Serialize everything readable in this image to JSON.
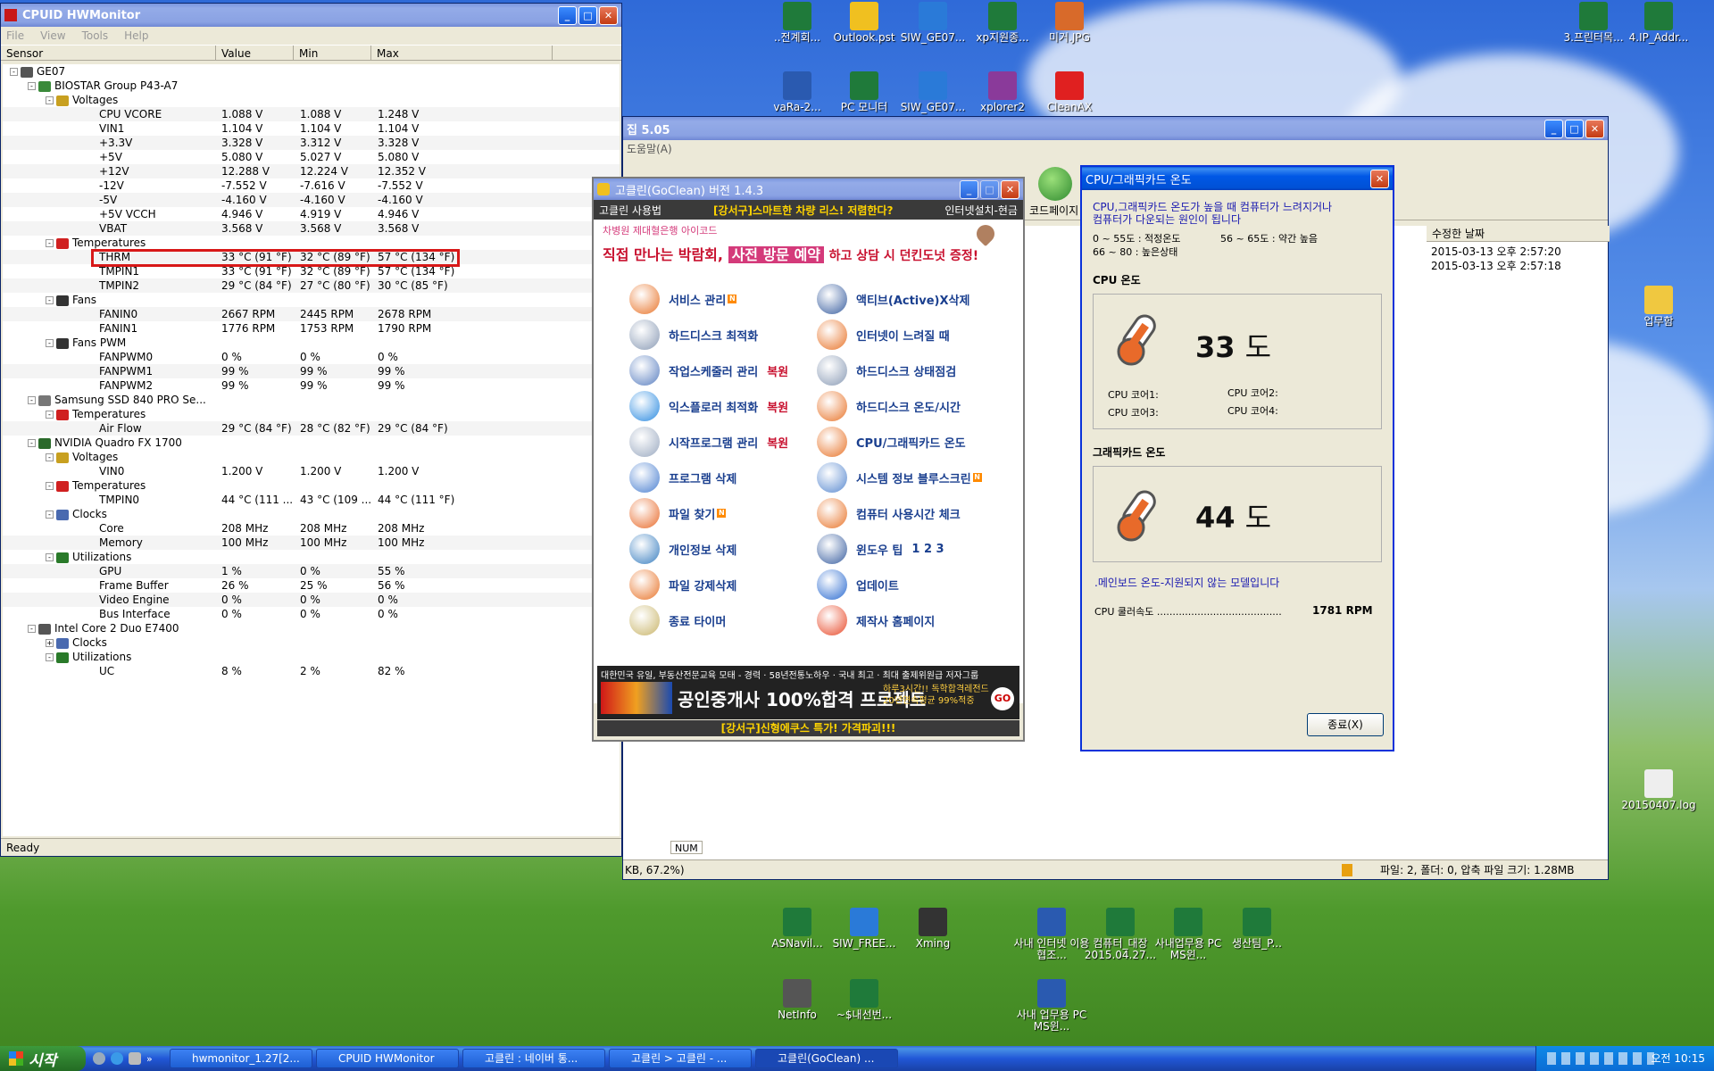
{
  "hwmonitor": {
    "title": "CPUID HWMonitor",
    "menu": [
      "File",
      "View",
      "Tools",
      "Help"
    ],
    "columns": [
      "Sensor",
      "Value",
      "Min",
      "Max"
    ],
    "rows": [
      {
        "indent": 0,
        "label": "GE07",
        "icon": "computer",
        "toggle": "-"
      },
      {
        "indent": 1,
        "label": "BIOSTAR Group P43-A7",
        "icon": "board",
        "toggle": "-"
      },
      {
        "indent": 2,
        "label": "Voltages",
        "icon": "volt",
        "toggle": "-"
      },
      {
        "indent": 3,
        "label": "CPU VCORE",
        "v": "1.088 V",
        "mn": "1.088 V",
        "mx": "1.248 V"
      },
      {
        "indent": 3,
        "label": "VIN1",
        "v": "1.104 V",
        "mn": "1.104 V",
        "mx": "1.104 V"
      },
      {
        "indent": 3,
        "label": "+3.3V",
        "v": "3.328 V",
        "mn": "3.312 V",
        "mx": "3.328 V"
      },
      {
        "indent": 3,
        "label": "+5V",
        "v": "5.080 V",
        "mn": "5.027 V",
        "mx": "5.080 V"
      },
      {
        "indent": 3,
        "label": "+12V",
        "v": "12.288 V",
        "mn": "12.224 V",
        "mx": "12.352 V"
      },
      {
        "indent": 3,
        "label": "-12V",
        "v": "-7.552 V",
        "mn": "-7.616 V",
        "mx": "-7.552 V"
      },
      {
        "indent": 3,
        "label": "-5V",
        "v": "-4.160 V",
        "mn": "-4.160 V",
        "mx": "-4.160 V"
      },
      {
        "indent": 3,
        "label": "+5V VCCH",
        "v": "4.946 V",
        "mn": "4.919 V",
        "mx": "4.946 V"
      },
      {
        "indent": 3,
        "label": "VBAT",
        "v": "3.568 V",
        "mn": "3.568 V",
        "mx": "3.568 V"
      },
      {
        "indent": 2,
        "label": "Temperatures",
        "icon": "temp",
        "toggle": "-"
      },
      {
        "indent": 3,
        "label": "THRM",
        "v": "33 °C  (91 °F)",
        "mn": "32 °C  (89 °F)",
        "mx": "57 °C  (134 °F)"
      },
      {
        "indent": 3,
        "label": "TMPIN1",
        "v": "33 °C  (91 °F)",
        "mn": "32 °C  (89 °F)",
        "mx": "57 °C  (134 °F)"
      },
      {
        "indent": 3,
        "label": "TMPIN2",
        "v": "29 °C  (84 °F)",
        "mn": "27 °C  (80 °F)",
        "mx": "30 °C  (85 °F)"
      },
      {
        "indent": 2,
        "label": "Fans",
        "icon": "fan",
        "toggle": "-"
      },
      {
        "indent": 3,
        "label": "FANIN0",
        "v": "2667 RPM",
        "mn": "2445 RPM",
        "mx": "2678 RPM"
      },
      {
        "indent": 3,
        "label": "FANIN1",
        "v": "1776 RPM",
        "mn": "1753 RPM",
        "mx": "1790 RPM"
      },
      {
        "indent": 2,
        "label": "Fans PWM",
        "icon": "fan",
        "toggle": "-"
      },
      {
        "indent": 3,
        "label": "FANPWM0",
        "v": "0 %",
        "mn": "0 %",
        "mx": "0 %"
      },
      {
        "indent": 3,
        "label": "FANPWM1",
        "v": "99 %",
        "mn": "99 %",
        "mx": "99 %"
      },
      {
        "indent": 3,
        "label": "FANPWM2",
        "v": "99 %",
        "mn": "99 %",
        "mx": "99 %"
      },
      {
        "indent": 1,
        "label": "Samsung SSD 840 PRO Se...",
        "icon": "disk",
        "toggle": "-"
      },
      {
        "indent": 2,
        "label": "Temperatures",
        "icon": "temp",
        "toggle": "-"
      },
      {
        "indent": 3,
        "label": "Air Flow",
        "v": "29 °C  (84 °F)",
        "mn": "28 °C  (82 °F)",
        "mx": "29 °C  (84 °F)"
      },
      {
        "indent": 1,
        "label": "NVIDIA Quadro FX 1700",
        "icon": "gpu",
        "toggle": "-"
      },
      {
        "indent": 2,
        "label": "Voltages",
        "icon": "volt",
        "toggle": "-"
      },
      {
        "indent": 3,
        "label": "VIN0",
        "v": "1.200 V",
        "mn": "1.200 V",
        "mx": "1.200 V"
      },
      {
        "indent": 2,
        "label": "Temperatures",
        "icon": "temp",
        "toggle": "-"
      },
      {
        "indent": 3,
        "label": "TMPIN0",
        "v": "44 °C  (111 ...",
        "mn": "43 °C  (109 ...",
        "mx": "44 °C  (111 °F)"
      },
      {
        "indent": 2,
        "label": "Clocks",
        "icon": "clock",
        "toggle": "-"
      },
      {
        "indent": 3,
        "label": "Core",
        "v": "208 MHz",
        "mn": "208 MHz",
        "mx": "208 MHz"
      },
      {
        "indent": 3,
        "label": "Memory",
        "v": "100 MHz",
        "mn": "100 MHz",
        "mx": "100 MHz"
      },
      {
        "indent": 2,
        "label": "Utilizations",
        "icon": "util",
        "toggle": "-"
      },
      {
        "indent": 3,
        "label": "GPU",
        "v": "1 %",
        "mn": "0 %",
        "mx": "55 %"
      },
      {
        "indent": 3,
        "label": "Frame Buffer",
        "v": "26 %",
        "mn": "25 %",
        "mx": "56 %"
      },
      {
        "indent": 3,
        "label": "Video Engine",
        "v": "0 %",
        "mn": "0 %",
        "mx": "0 %"
      },
      {
        "indent": 3,
        "label": "Bus Interface",
        "v": "0 %",
        "mn": "0 %",
        "mx": "0 %"
      },
      {
        "indent": 1,
        "label": "Intel Core 2 Duo E7400",
        "icon": "cpu",
        "toggle": "-"
      },
      {
        "indent": 2,
        "label": "Clocks",
        "icon": "clock",
        "toggle": "+"
      },
      {
        "indent": 2,
        "label": "Utilizations",
        "icon": "util",
        "toggle": "-"
      },
      {
        "indent": 3,
        "label": "UC",
        "v": "8 %",
        "mn": "2 %",
        "mx": "82 %"
      }
    ],
    "status": "Ready",
    "status_num": "NUM"
  },
  "archive": {
    "title": "집 5.05",
    "menu": "도움말(A)",
    "toolbar_label": "코드페이지",
    "col_date": "수정한 날짜",
    "dates": [
      "2015-03-13 오후 2:57:20",
      "2015-03-13 오후 2:57:18"
    ],
    "status_left": "KB, 67.2%)",
    "status_right": "파일: 2, 폴더: 0, 압축 파일 크기: 1.28MB"
  },
  "goclean": {
    "title": "고클린(GoClean) 버전 1.4.3",
    "bar_left": "고클린 사용법",
    "bar_mid": "[강서구]스마트한 차량 리스! 저렴한다?",
    "bar_right": "인터넷설치-현금",
    "ad_small": "차병원 제대혈은행 아이코드",
    "ad_big_a": "직접 만나는 박람회,",
    "ad_big_b": "사전 방문 예약",
    "ad_big_c": "하고 상담 시 던킨도넛 증정!",
    "left_items": [
      {
        "label": "서비스 관리",
        "badge": "N",
        "extra": "",
        "color": "#e8742a"
      },
      {
        "label": "하드디스크 최적화",
        "badge": "",
        "extra": "",
        "color": "#8a9bb5"
      },
      {
        "label": "작업스케줄러 관리",
        "badge": "",
        "extra": "복원",
        "color": "#5a7fc0"
      },
      {
        "label": "익스플로러 최적화",
        "badge": "",
        "extra": "복원",
        "color": "#2a8ae0"
      },
      {
        "label": "시작프로그램 관리",
        "badge": "",
        "extra": "복원",
        "color": "#9aa9c0"
      },
      {
        "label": "프로그램 삭제",
        "badge": "",
        "extra": "",
        "color": "#4a7fd0"
      },
      {
        "label": "파일 찾기",
        "badge": "N",
        "extra": "",
        "color": "#e86a2a"
      },
      {
        "label": "개인정보 삭제",
        "badge": "",
        "extra": "",
        "color": "#3a7fc0"
      },
      {
        "label": "파일 강제삭제",
        "badge": "",
        "extra": "",
        "color": "#e8742a"
      },
      {
        "label": "종료 타이머",
        "badge": "",
        "extra": "",
        "color": "#c9b56a"
      }
    ],
    "right_items": [
      {
        "label": "액티브(Active)X삭제",
        "badge": "",
        "extra": "",
        "color": "#3a5fa0"
      },
      {
        "label": "인터넷이 느려질 때",
        "badge": "",
        "extra": "",
        "color": "#e8742a"
      },
      {
        "label": "하드디스크 상태점검",
        "badge": "",
        "extra": "",
        "color": "#8a9bb5"
      },
      {
        "label": "하드디스크 온도/시간",
        "badge": "",
        "extra": "",
        "color": "#e8742a"
      },
      {
        "label": "CPU/그래픽카드 온도",
        "badge": "",
        "extra": "",
        "color": "#e8742a"
      },
      {
        "label": "시스템 정보 블루스크린",
        "badge": "N",
        "extra": "",
        "color": "#5a8ad0"
      },
      {
        "label": "컴퓨터 사용시간 체크",
        "badge": "",
        "extra": "",
        "color": "#e8742a"
      },
      {
        "label": "윈도우 팁",
        "badge": "",
        "extra": "1   2   3",
        "color": "#3a5fa0"
      },
      {
        "label": "업데이트",
        "badge": "",
        "extra": "",
        "color": "#2a6ad0"
      },
      {
        "label": "제작사 홈페이지",
        "badge": "",
        "extra": "",
        "color": "#e84a2a"
      }
    ],
    "ad2_top": "대한민국 유일, 부동산전문교육 모태 - 경력 · 58년전통노하우 · 국내 최고 · 최대 출제위원급 저자그룹",
    "ad2_main": "공인중개사 100%합격 프로젝트",
    "ad2_side": "하루3시간!! 독학합격레전드 20년연속평균 99%적중",
    "ad2_go": "GO",
    "footer": "[강서구]신형에쿠스 특가! 가격파괴!!!"
  },
  "temp": {
    "title": "CPU/그래픽카드 온도",
    "info1": "CPU,그래픽카드 온도가 높을 때 컴퓨터가 느려지거나",
    "info2": "컴퓨터가 다운되는 원인이 됩니다",
    "range1": "0  ~ 55도 : 적정온도",
    "range2": "56 ~ 65도 : 약간 높음",
    "range3": "66 ~ 80 : 높은상태",
    "cpu_label": "CPU 온도",
    "cpu_value": "33",
    "unit": "도",
    "core1": "CPU 코어1:",
    "core2": "CPU 코어2:",
    "core3": "CPU 코어3:",
    "core4": "CPU 코어4:",
    "gpu_label": "그래픽카드 온도",
    "gpu_value": "44",
    "mb_note": ".메인보드 온도-지원되지 않는 모델입니다",
    "fan_label": "CPU 쿨러속도 ........................................",
    "fan_value": "1781 RPM",
    "close_btn": "종료(X)"
  },
  "desktop_icons": [
    {
      "label": "..전계회...",
      "type": "xls"
    },
    {
      "label": "Outlook.pst",
      "type": "pst"
    },
    {
      "label": "SIW_GE07...",
      "type": "ie"
    },
    {
      "label": "xp지원종...",
      "type": "xls"
    },
    {
      "label": "미거.JPG",
      "type": "jpg"
    },
    {
      "label": "vaRa-2...",
      "type": "zip"
    },
    {
      "label": "PC 모니터",
      "type": "xls"
    },
    {
      "label": "SIW_GE07...",
      "type": "ie"
    },
    {
      "label": "xplorer2",
      "type": "rar"
    },
    {
      "label": "CleanAX",
      "type": "active"
    },
    {
      "label": "3.프린터목...",
      "type": "xls"
    },
    {
      "label": "4.IP_Addr...",
      "type": "xls"
    },
    {
      "label": "업무함",
      "type": "folder"
    },
    {
      "label": "20150407.log",
      "type": "log"
    },
    {
      "label": "ASNavil...",
      "type": "xls"
    },
    {
      "label": "SIW_FREE...",
      "type": "ie"
    },
    {
      "label": "Xming",
      "type": "xming"
    },
    {
      "label": "사내 인터넷 이용 협조...",
      "type": "doc"
    },
    {
      "label": "컴퓨터_대장 2015.04.27...",
      "type": "xls"
    },
    {
      "label": "사내업무용 PC MS윈...",
      "type": "xls"
    },
    {
      "label": "생산팀_P...",
      "type": "xls"
    },
    {
      "label": "NetInfo",
      "type": "netinfo"
    },
    {
      "label": "~$내선번...",
      "type": "xls"
    },
    {
      "label": "사내 업무용 PC MS윈...",
      "type": "doc"
    }
  ],
  "taskbar": {
    "start": "시작",
    "items": [
      "hwmonitor_1.27[2...",
      "CPUID HWMonitor",
      "고클린 : 네이버 통...",
      "고클린 > 고클린 - ...",
      "고클린(GoClean) ..."
    ],
    "clock": "오전 10:15"
  }
}
